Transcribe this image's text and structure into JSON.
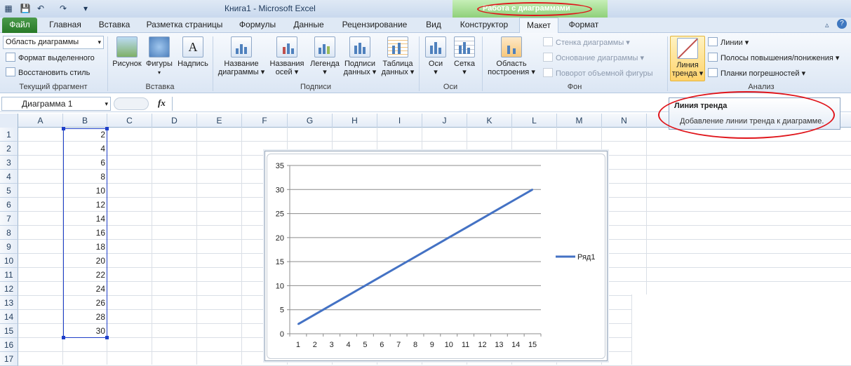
{
  "window": {
    "title": "Книга1  -  Microsoft Excel",
    "context_title": "Работа с диаграммами"
  },
  "tabs": [
    {
      "label": "Файл"
    },
    {
      "label": "Главная"
    },
    {
      "label": "Вставка"
    },
    {
      "label": "Разметка страницы"
    },
    {
      "label": "Формулы"
    },
    {
      "label": "Данные"
    },
    {
      "label": "Рецензирование"
    },
    {
      "label": "Вид"
    },
    {
      "label": "Конструктор"
    },
    {
      "label": "Макет",
      "active": true
    },
    {
      "label": "Формат"
    }
  ],
  "ribbon": {
    "current": {
      "selector_value": "Область диаграммы",
      "format_selection": "Формат выделенного",
      "reset_style": "Восстановить стиль",
      "label": "Текущий фрагмент"
    },
    "insert": {
      "picture": "Рисунок",
      "shapes": "Фигуры",
      "textbox": "Надпись",
      "label": "Вставка"
    },
    "labels": {
      "chart_title_1": "Название",
      "chart_title_2": "диаграммы",
      "axis_titles_1": "Названия",
      "axis_titles_2": "осей",
      "legend": "Легенда",
      "data_labels_1": "Подписи",
      "data_labels_2": "данных",
      "data_table_1": "Таблица",
      "data_table_2": "данных",
      "label": "Подписи"
    },
    "axes": {
      "axes": "Оси",
      "gridlines": "Сетка",
      "label": "Оси"
    },
    "background": {
      "plot_area_1": "Область",
      "plot_area_2": "построения",
      "chart_wall": "Стенка диаграммы",
      "chart_floor": "Основание диаграммы",
      "rotation": "Поворот объемной фигуры",
      "label": "Фон"
    },
    "analysis": {
      "trendline_1": "Линия",
      "trendline_2": "тренда",
      "lines": "Линии",
      "updown_bars": "Полосы повышения/понижения",
      "error_bars": "Планки погрешностей",
      "label": "Анализ"
    }
  },
  "formula_bar": {
    "name_box": "Диаграмма 1",
    "fx": "fx",
    "value": ""
  },
  "grid": {
    "columns": [
      "A",
      "B",
      "C",
      "D",
      "E",
      "F",
      "G",
      "H",
      "I",
      "J",
      "K",
      "L",
      "M",
      "N"
    ],
    "rows": [
      "1",
      "2",
      "3",
      "4",
      "5",
      "6",
      "7",
      "8",
      "9",
      "10",
      "11",
      "12",
      "13",
      "14",
      "15",
      "16",
      "17"
    ],
    "column_b_values": [
      "2",
      "4",
      "6",
      "8",
      "10",
      "12",
      "14",
      "16",
      "18",
      "20",
      "22",
      "24",
      "26",
      "28",
      "30"
    ]
  },
  "tooltip": {
    "title": "Линия тренда",
    "description": "Добавление линии тренда к диаграмме."
  },
  "chart_data": {
    "type": "line",
    "x": [
      1,
      2,
      3,
      4,
      5,
      6,
      7,
      8,
      9,
      10,
      11,
      12,
      13,
      14,
      15
    ],
    "series": [
      {
        "name": "Ряд1",
        "values": [
          2,
          4,
          6,
          8,
          10,
          12,
          14,
          16,
          18,
          20,
          22,
          24,
          26,
          28,
          30
        ],
        "color": "#4472c4"
      }
    ],
    "ylim": [
      0,
      35
    ],
    "yticks": [
      "0",
      "5",
      "10",
      "15",
      "20",
      "25",
      "30",
      "35"
    ],
    "xticks": [
      "1",
      "2",
      "3",
      "4",
      "5",
      "6",
      "7",
      "8",
      "9",
      "10",
      "11",
      "12",
      "13",
      "14",
      "15"
    ],
    "grid": true,
    "legend": "right"
  },
  "colors": {
    "accent": "#2b579a",
    "file_tab": "#2a7d2a",
    "context": "#8fd07a",
    "annotation": "#e0151b",
    "selection": "#1e3fc9"
  }
}
